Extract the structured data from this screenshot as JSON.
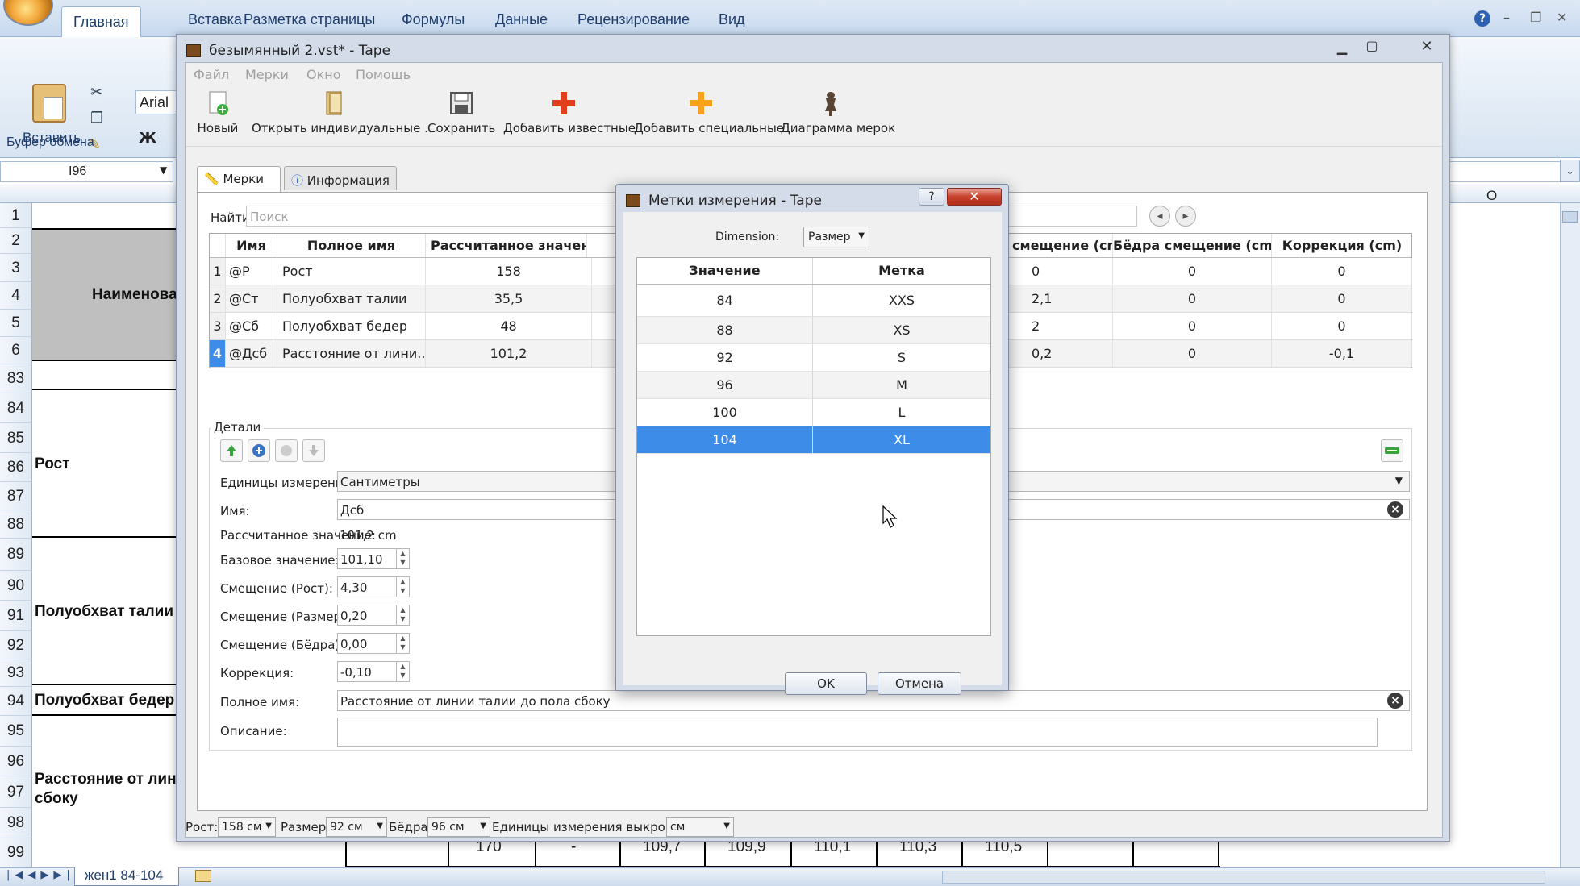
{
  "excel": {
    "tabs": [
      "Главная",
      "Вставка",
      "Разметка страницы",
      "Формулы",
      "Данные",
      "Рецензирование",
      "Вид"
    ],
    "clipboard": {
      "paste_label": "Вставить",
      "group_label": "Буфер обмена"
    },
    "font_name": "Arial",
    "bold_label": "Ж",
    "name_box": "I96",
    "column_O": "O",
    "rows": [
      "1",
      "2",
      "3",
      "4",
      "5",
      "6",
      "83",
      "84",
      "85",
      "86",
      "87",
      "88",
      "89",
      "90",
      "91",
      "92",
      "93",
      "94",
      "95",
      "96",
      "97",
      "98",
      "99"
    ],
    "cells": {
      "naimenova": "Наименова",
      "rost": "Рост",
      "taliya": "Полуобхват талии",
      "bedra": "Полуобхват бедер",
      "rasst1": "Расстояние от лин",
      "rasst2": "сбоку"
    },
    "bottom_row": [
      "170",
      "-",
      "109,7",
      "109,9",
      "110,1",
      "110,3",
      "110,5"
    ],
    "sheet_tab": "жен1 84-104"
  },
  "tape": {
    "title": "безымянный 2.vst* - Tape",
    "menu": [
      "Файл",
      "Мерки",
      "Окно",
      "Помощь"
    ],
    "toolbar": {
      "new": "Новый",
      "open": "Открыть индивидуальные ...",
      "save": "Сохранить",
      "add_known": "Добавить известные",
      "add_special": "Добавить специальные",
      "diagram": "Диаграмма мерок"
    },
    "tabs": {
      "measures": "Мерки",
      "info": "Информация"
    },
    "find_label": "Найти:",
    "find_placeholder": "Поиск",
    "table": {
      "headers": {
        "name": "Имя",
        "fullname": "Полное имя",
        "calc": "Рассчитанное значение (cm)",
        "shift_size": "смещение (cm)",
        "shift_hips": "Бёдра смещение (cm)",
        "correction": "Коррекция (cm)"
      },
      "rows": [
        {
          "n": "1",
          "name": "@Р",
          "fullname": "Рост",
          "calc": "158",
          "shift": "0",
          "hips": "0",
          "corr": "0"
        },
        {
          "n": "2",
          "name": "@Ст",
          "fullname": "Полуобхват талии",
          "calc": "35,5",
          "shift": "2,1",
          "hips": "0",
          "corr": "0"
        },
        {
          "n": "3",
          "name": "@Сб",
          "fullname": "Полуобхват бедер",
          "calc": "48",
          "shift": "2",
          "hips": "0",
          "corr": "0"
        },
        {
          "n": "4",
          "name": "@Дсб",
          "fullname": "Расстояние от лини...",
          "calc": "101,2",
          "shift": "0,2",
          "hips": "0",
          "corr": "-0,1"
        }
      ]
    },
    "details": {
      "title": "Детали",
      "units_label": "Единицы измерения:",
      "units_value": "Сантиметры",
      "name_label": "Имя:",
      "name_value": "Дсб",
      "calc_label": "Рассчитанное значение:",
      "calc_value": "101,2 cm",
      "base_label": "Базовое значение:",
      "base_value": "101,10",
      "shift_height_label": "Смещение (Рост):",
      "shift_height_value": "4,30",
      "shift_size_label": "Смещение (Размер):",
      "shift_size_value": "0,20",
      "shift_hips_label": "Смещение (Бёдра):",
      "shift_hips_value": "0,00",
      "corr_label": "Коррекция:",
      "corr_value": "-0,10",
      "fullname_label": "Полное имя:",
      "fullname_value": "Расстояние от линии талии до пола сбоку",
      "desc_label": "Описание:"
    },
    "status": {
      "height_label": "Рост:",
      "height_value": "158 см",
      "size_label": "Размер:",
      "size_value": "92 см",
      "hips_label": "Бёдра:",
      "hips_value": "96 см",
      "units_label": "Единицы измерения выкройки:",
      "units_value": "см"
    }
  },
  "dialog": {
    "title": "Метки измерения - Tape",
    "help": "?",
    "dimension_label": "Dimension:",
    "dimension_value": "Размер",
    "headers": {
      "value": "Значение",
      "label": "Метка"
    },
    "rows": [
      {
        "value": "84",
        "label": "XXS"
      },
      {
        "value": "88",
        "label": "XS"
      },
      {
        "value": "92",
        "label": "S"
      },
      {
        "value": "96",
        "label": "M"
      },
      {
        "value": "100",
        "label": "L"
      },
      {
        "value": "104",
        "label": "XL"
      }
    ],
    "ok": "OK",
    "cancel": "Отмена"
  }
}
